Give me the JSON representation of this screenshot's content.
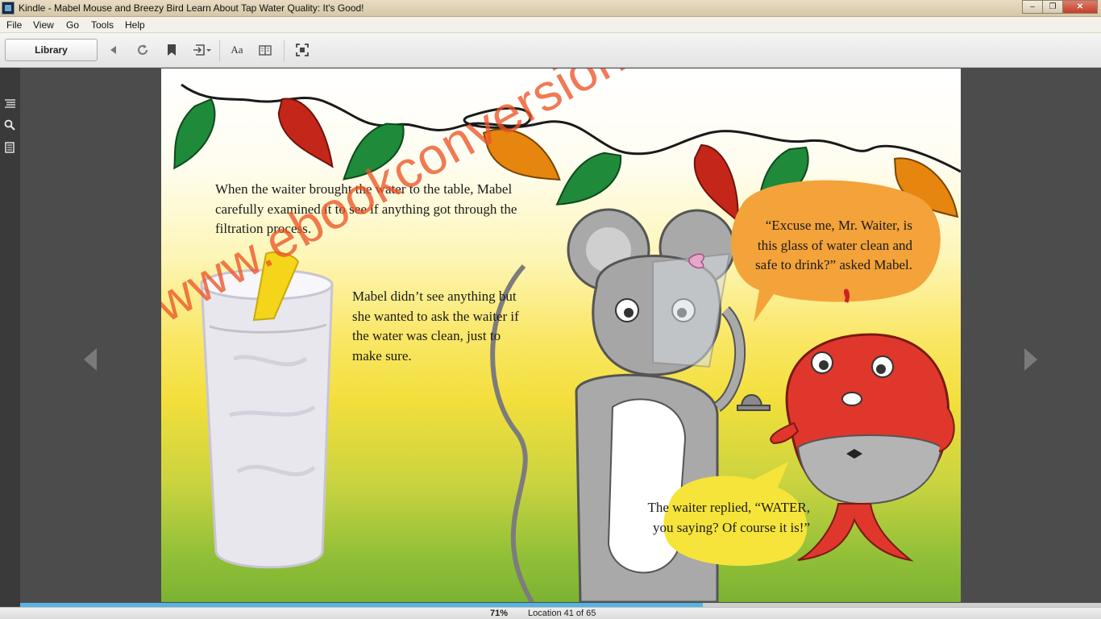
{
  "window": {
    "title": "Kindle - Mabel Mouse and Breezy Bird Learn About Tap Water Quality: It's Good!",
    "buttons": {
      "minimize": "–",
      "maximize": "❐",
      "close": "✕"
    }
  },
  "menu": {
    "items": [
      {
        "label": "File"
      },
      {
        "label": "View"
      },
      {
        "label": "Go"
      },
      {
        "label": "Tools"
      },
      {
        "label": "Help"
      }
    ]
  },
  "toolbar": {
    "library_label": "Library",
    "font_label": "Aa",
    "icons": [
      "back-icon",
      "sync-icon",
      "bookmark-icon",
      "goto-icon",
      "font-icon",
      "view-mode-icon",
      "fullscreen-icon"
    ]
  },
  "sidebar": {
    "icons": [
      "toc-icon",
      "search-icon",
      "notes-icon"
    ]
  },
  "page": {
    "paragraph_1": "When the waiter brought the water to the table, Mabel carefully examined it to see if anything got through the filtration process.",
    "paragraph_2": "Mabel didn’t see anything but she wanted to ask the waiter if the water was clean, just to make sure.",
    "bubble_mabel": "“Excuse me, Mr. Waiter, is this glass of water clean and safe to drink?” asked Mabel.",
    "bubble_waiter": "The waiter replied, “WATER, you saying? Of course it is!”",
    "watermark": "www.ebookconversion.com"
  },
  "status": {
    "progress_percent": 71,
    "percent_label": "71%",
    "location_label": "Location 41 of 65"
  },
  "colors": {
    "progress": "#56b4e3",
    "watermark": "#ec5528",
    "pepper_green": "#1f8a3a",
    "pepper_red": "#c4271a",
    "pepper_orange": "#e7860f",
    "waiter_red": "#e0372c",
    "bubble_orange": "#f3a33a",
    "bubble_yellow": "#f6e43a"
  }
}
